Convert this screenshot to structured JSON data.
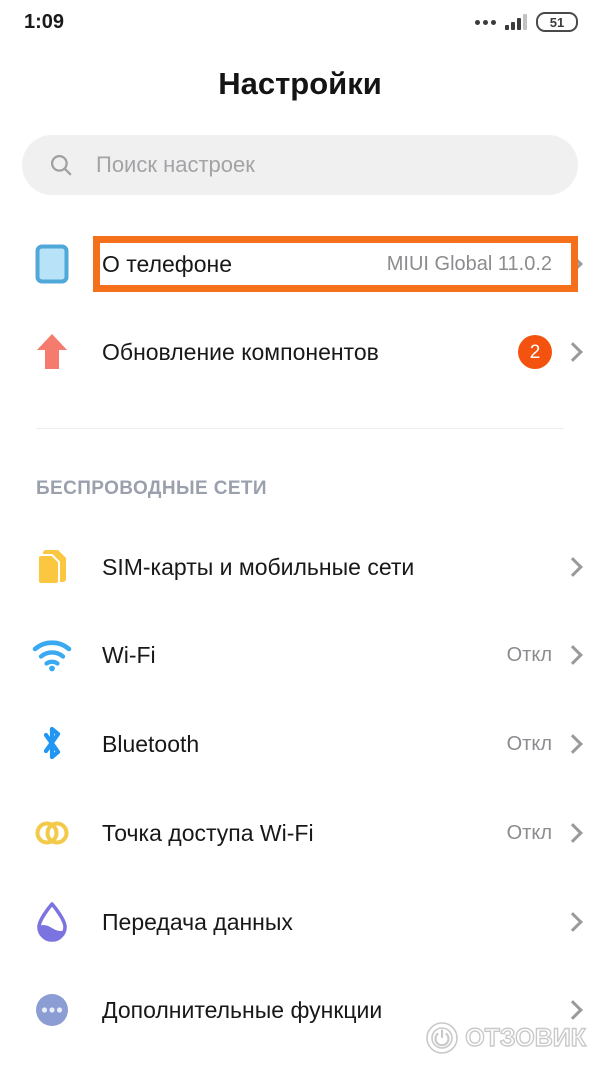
{
  "status_bar": {
    "time": "1:09",
    "battery_level": "51",
    "dots_icon": "more-dots-icon",
    "signal_icon": "signal-bars-icon",
    "battery_icon": "battery-icon"
  },
  "header": {
    "title": "Настройки"
  },
  "search": {
    "placeholder": "Поиск настроек",
    "value": "",
    "icon": "search-icon"
  },
  "highlight": {
    "color": "#f4701b",
    "target": "about-phone-row"
  },
  "top_items": [
    {
      "label": "О телефоне",
      "value": "MIUI Global 11.0.2",
      "icon": "phone-icon",
      "icon_color": "#a9dcf5",
      "badge": null,
      "highlighted": true
    },
    {
      "label": "Обновление компонентов",
      "value": "",
      "icon": "up-arrow-icon",
      "icon_color": "#f57b6e",
      "badge": "2",
      "highlighted": false
    }
  ],
  "sections": [
    {
      "header": "БЕСПРОВОДНЫЕ СЕТИ",
      "items": [
        {
          "label": "SIM-карты и мобильные сети",
          "value": "",
          "icon": "sim-card-icon",
          "icon_color": "#fbc02d"
        },
        {
          "label": "Wi-Fi",
          "value": "Откл",
          "icon": "wifi-icon",
          "icon_color": "#3aa9f0"
        },
        {
          "label": "Bluetooth",
          "value": "Откл",
          "icon": "bluetooth-icon",
          "icon_color": "#2196f3"
        },
        {
          "label": "Точка доступа Wi-Fi",
          "value": "Откл",
          "icon": "hotspot-icon",
          "icon_color": "#f3c948"
        },
        {
          "label": "Передача данных",
          "value": "",
          "icon": "data-drop-icon",
          "icon_color": "#7b74e0"
        },
        {
          "label": "Дополнительные функции",
          "value": "",
          "icon": "more-functions-icon",
          "icon_color": "#8c9dd4"
        }
      ]
    }
  ],
  "watermark": {
    "text": "ОТЗОВИК",
    "logo": "otzovik-logo-icon"
  }
}
